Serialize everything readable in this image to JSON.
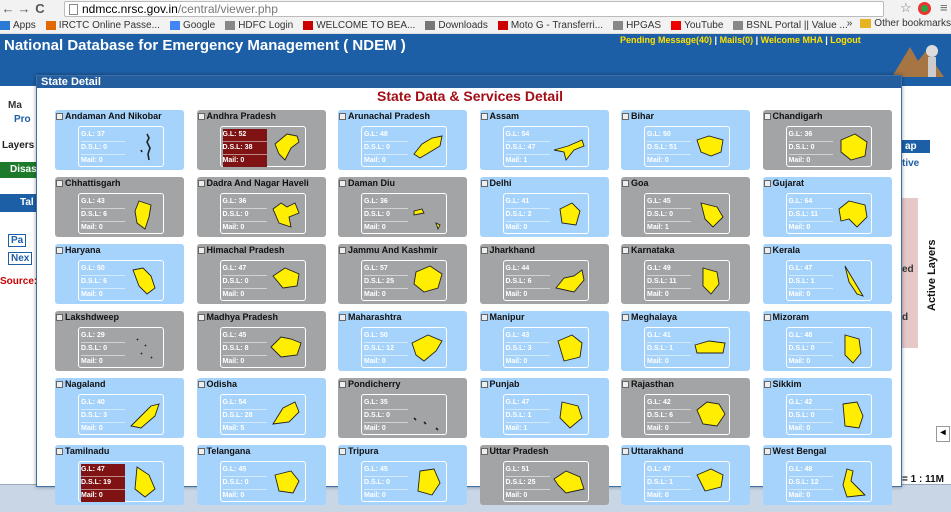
{
  "browser": {
    "url_domain": "ndmcc.nrsc.gov.in",
    "url_path": "/central/viewer.php",
    "bookmarks": [
      "Apps",
      "IRCTC Online Passe...",
      "Google",
      "HDFC Login",
      "WELCOME TO BEA...",
      "Downloads",
      "Moto G - Transferri...",
      "HPGAS",
      "YouTube",
      "BSNL Portal || Value ..."
    ],
    "overflow": "»",
    "other_bookmarks": "Other bookmarks"
  },
  "app": {
    "title": "National Database for Emergency Management ( NDEM )",
    "pending": "Pending Message(40)",
    "mails": "Mails(0)",
    "welcome": "Welcome MHA",
    "logout": "Logout",
    "separator": "|"
  },
  "left_panel": {
    "layers": "Layers",
    "disaster": "Disast",
    "tab": "Tal",
    "prev": "Pa",
    "next": "Nex",
    "source": "Source:Tl",
    "pro": "Pro",
    "ma": "Ma"
  },
  "right_panel": {
    "map_label": "ap",
    "active": "tive",
    "active_layers": "Active Layers",
    "scale": "= 1 : 11M",
    "manual": "lanual",
    "ed": "ed",
    "d": "d"
  },
  "modal": {
    "header": "State Detail",
    "title": "State Data & Services Detail"
  },
  "labels": {
    "gl": "G.L: ",
    "dsl": "D.S.L: ",
    "mail": "Mail: "
  },
  "colors": {
    "blue_tile": "#a6d3fb",
    "gray_tile": "#a2a4a6",
    "alert": "#7f1212",
    "state_fill": "#ffee00"
  },
  "states": [
    {
      "name": "Andaman And Nikobar",
      "gl": "37",
      "dsl": "0",
      "mail": "0",
      "tone": "blue",
      "alert": false
    },
    {
      "name": "Andhra Pradesh",
      "gl": "52",
      "dsl": "38",
      "mail": "0",
      "tone": "gray",
      "alert": true
    },
    {
      "name": "Arunachal Pradesh",
      "gl": "48",
      "dsl": "0",
      "mail": "0",
      "tone": "blue",
      "alert": false
    },
    {
      "name": "Assam",
      "gl": "54",
      "dsl": "47",
      "mail": "1",
      "tone": "blue",
      "alert": false
    },
    {
      "name": "Bihar",
      "gl": "50",
      "dsl": "51",
      "mail": "0",
      "tone": "blue",
      "alert": false
    },
    {
      "name": "Chandigarh",
      "gl": "36",
      "dsl": "0",
      "mail": "0",
      "tone": "gray",
      "alert": false
    },
    {
      "name": "Chhattisgarh",
      "gl": "43",
      "dsl": "6",
      "mail": "0",
      "tone": "gray",
      "alert": false
    },
    {
      "name": "Dadra And Nagar Haveli",
      "gl": "36",
      "dsl": "0",
      "mail": "0",
      "tone": "gray",
      "alert": false
    },
    {
      "name": "Daman Diu",
      "gl": "36",
      "dsl": "0",
      "mail": "0",
      "tone": "gray",
      "alert": false
    },
    {
      "name": "Delhi",
      "gl": "41",
      "dsl": "2",
      "mail": "0",
      "tone": "blue",
      "alert": false
    },
    {
      "name": "Goa",
      "gl": "45",
      "dsl": "0",
      "mail": "1",
      "tone": "gray",
      "alert": false
    },
    {
      "name": "Gujarat",
      "gl": "64",
      "dsl": "11",
      "mail": "0",
      "tone": "blue",
      "alert": false
    },
    {
      "name": "Haryana",
      "gl": "50",
      "dsl": "6",
      "mail": "0",
      "tone": "blue",
      "alert": false
    },
    {
      "name": "Himachal Pradesh",
      "gl": "47",
      "dsl": "0",
      "mail": "0",
      "tone": "gray",
      "alert": false
    },
    {
      "name": "Jammu And Kashmir",
      "gl": "57",
      "dsl": "25",
      "mail": "0",
      "tone": "gray",
      "alert": false
    },
    {
      "name": "Jharkhand",
      "gl": "44",
      "dsl": "6",
      "mail": "0",
      "tone": "gray",
      "alert": false
    },
    {
      "name": "Karnataka",
      "gl": "49",
      "dsl": "11",
      "mail": "0",
      "tone": "gray",
      "alert": false
    },
    {
      "name": "Kerala",
      "gl": "47",
      "dsl": "1",
      "mail": "0",
      "tone": "blue",
      "alert": false
    },
    {
      "name": "Lakshdweep",
      "gl": "29",
      "dsl": "0",
      "mail": "0",
      "tone": "gray",
      "alert": false
    },
    {
      "name": "Madhya Pradesh",
      "gl": "45",
      "dsl": "8",
      "mail": "0",
      "tone": "gray",
      "alert": false
    },
    {
      "name": "Maharashtra",
      "gl": "50",
      "dsl": "12",
      "mail": "0",
      "tone": "blue",
      "alert": false
    },
    {
      "name": "Manipur",
      "gl": "43",
      "dsl": "3",
      "mail": "0",
      "tone": "blue",
      "alert": false
    },
    {
      "name": "Meghalaya",
      "gl": "41",
      "dsl": "1",
      "mail": "0",
      "tone": "blue",
      "alert": false
    },
    {
      "name": "Mizoram",
      "gl": "48",
      "dsl": "0",
      "mail": "0",
      "tone": "blue",
      "alert": false
    },
    {
      "name": "Nagaland",
      "gl": "40",
      "dsl": "3",
      "mail": "0",
      "tone": "blue",
      "alert": false
    },
    {
      "name": "Odisha",
      "gl": "54",
      "dsl": "28",
      "mail": "5",
      "tone": "blue",
      "alert": false
    },
    {
      "name": "Pondicherry",
      "gl": "35",
      "dsl": "0",
      "mail": "0",
      "tone": "gray",
      "alert": false
    },
    {
      "name": "Punjab",
      "gl": "47",
      "dsl": "1",
      "mail": "1",
      "tone": "blue",
      "alert": false
    },
    {
      "name": "Rajasthan",
      "gl": "42",
      "dsl": "6",
      "mail": "0",
      "tone": "gray",
      "alert": false
    },
    {
      "name": "Sikkim",
      "gl": "42",
      "dsl": "0",
      "mail": "0",
      "tone": "blue",
      "alert": false
    },
    {
      "name": "Tamilnadu",
      "gl": "47",
      "dsl": "19",
      "mail": "0",
      "tone": "blue",
      "alert": true
    },
    {
      "name": "Telangana",
      "gl": "45",
      "dsl": "0",
      "mail": "0",
      "tone": "blue",
      "alert": false
    },
    {
      "name": "Tripura",
      "gl": "45",
      "dsl": "0",
      "mail": "0",
      "tone": "blue",
      "alert": false
    },
    {
      "name": "Uttar Pradesh",
      "gl": "51",
      "dsl": "25",
      "mail": "0",
      "tone": "gray",
      "alert": false
    },
    {
      "name": "Uttarakhand",
      "gl": "47",
      "dsl": "1",
      "mail": "0",
      "tone": "blue",
      "alert": false
    },
    {
      "name": "West Bengal",
      "gl": "48",
      "dsl": "12",
      "mail": "0",
      "tone": "blue",
      "alert": false
    }
  ]
}
